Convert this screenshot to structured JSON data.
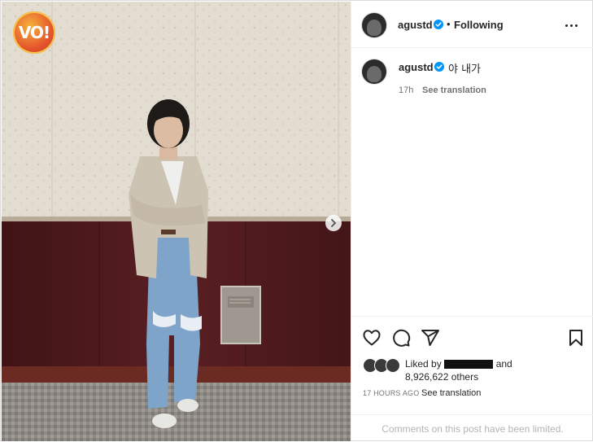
{
  "logo": {
    "text": "VO!"
  },
  "header": {
    "username": "agustd",
    "separator": "•",
    "follow_status": "Following"
  },
  "caption": {
    "username": "agustd",
    "text": "야 내가",
    "time": "17h",
    "see_translation": "See translation"
  },
  "actions": {
    "icons": [
      "heart-icon",
      "comment-icon",
      "share-icon",
      "bookmark-icon"
    ]
  },
  "likes": {
    "prefix": "Liked by",
    "suffix": "and",
    "count_text": "8,926,622 others"
  },
  "post": {
    "timestamp": "17 HOURS AGO",
    "see_translation": "See translation"
  },
  "comments": {
    "limited_notice": "Comments on this post have been limited."
  },
  "colors": {
    "verified": "#0095f6",
    "wall_upper": "#e4ded3",
    "wall_lower": "#4e1a1c",
    "carpet": "#8c8a86",
    "logo": "#e5542c"
  }
}
